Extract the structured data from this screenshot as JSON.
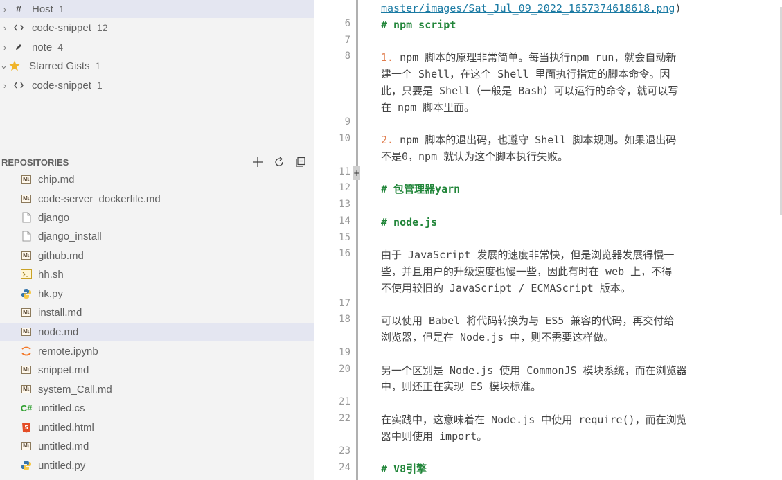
{
  "sidebar": {
    "tree": [
      {
        "label": "Host",
        "count": "1",
        "icon": "hash-icon"
      },
      {
        "label": "code-snippet",
        "count": "12",
        "icon": "code-icon"
      },
      {
        "label": "note",
        "count": "4",
        "icon": "pencil-icon"
      },
      {
        "label": "Starred Gists",
        "count": "1",
        "icon": "star-icon"
      },
      {
        "label": "code-snippet",
        "count": "1",
        "icon": "code-icon"
      }
    ],
    "repositories": {
      "title": "REPOSITORIES",
      "files": [
        {
          "name": "chip.md",
          "icon": "markdown-icon"
        },
        {
          "name": "code-server_dockerfile.md",
          "icon": "markdown-icon"
        },
        {
          "name": "django",
          "icon": "file-icon"
        },
        {
          "name": "django_install",
          "icon": "file-icon"
        },
        {
          "name": "github.md",
          "icon": "markdown-icon"
        },
        {
          "name": "hh.sh",
          "icon": "terminal-icon"
        },
        {
          "name": "hk.py",
          "icon": "python-icon"
        },
        {
          "name": "install.md",
          "icon": "markdown-icon"
        },
        {
          "name": "node.md",
          "icon": "markdown-icon"
        },
        {
          "name": "remote.ipynb",
          "icon": "jupyter-icon"
        },
        {
          "name": "snippet.md",
          "icon": "markdown-icon"
        },
        {
          "name": "system_Call.md",
          "icon": "markdown-icon"
        },
        {
          "name": "untitled.cs",
          "icon": "csharp-icon"
        },
        {
          "name": "untitled.html",
          "icon": "html-icon"
        },
        {
          "name": "untitled.md",
          "icon": "markdown-icon"
        },
        {
          "name": "untitled.py",
          "icon": "python-icon"
        }
      ],
      "selected": "node.md"
    }
  },
  "editor": {
    "line_numbers": [
      "6",
      "7",
      "8",
      "9",
      "10",
      "11",
      "12",
      "13",
      "14",
      "15",
      "16",
      "17",
      "18",
      "19",
      "20",
      "21",
      "22",
      "23",
      "24"
    ],
    "lines": {
      "link": "master/images/Sat_Jul_09_2022_1657374618618.png",
      "link_close": ")",
      "h_npm_script": "# npm script",
      "p1_num": "1.",
      "p1_l1": " npm 脚本的原理非常简单。每当执行npm run，就会自动新",
      "p1_l2": "建一个 Shell，在这个 Shell 里面执行指定的脚本命令。因",
      "p1_l3": "此，只要是 Shell（一般是 Bash）可以运行的命令，就可以写",
      "p1_l4": "在 npm 脚本里面。",
      "p2_num": "2.",
      "p2_l1": " npm 脚本的退出码，也遵守 Shell 脚本规则。如果退出码",
      "p2_l2": "不是0，npm 就认为这个脚本执行失败。",
      "h_yarn": "# 包管理器yarn",
      "h_node": "# node.js",
      "p3_l1": "由于 JavaScript 发展的速度非常快，但是浏览器发展得慢一",
      "p3_l2": "些，并且用户的升级速度也慢一些，因此有时在 web 上，不得",
      "p3_l3": "不使用较旧的 JavaScript / ECMAScript 版本。",
      "p4_l1": "可以使用 Babel 将代码转换为与 ES5 兼容的代码，再交付给",
      "p4_l2": "浏览器，但是在 Node.js 中，则不需要这样做。",
      "p5_l1": "另一个区别是 Node.js 使用 CommonJS 模块系统，而在浏览器",
      "p5_l2": "中，则还正在实现 ES 模块标准。",
      "p6_l1": "在实践中，这意味着在 Node.js 中使用 require()，而在浏览",
      "p6_l2": "器中则使用 import。",
      "h_v8": "# V8引擎"
    },
    "add_marker": "+"
  },
  "colors": {
    "sidebar_bg": "#f3f3f3",
    "selected_row": "#e4e6f1",
    "heading": "#22863a",
    "list_number": "#e07c4c",
    "link": "#1a7aa3"
  }
}
